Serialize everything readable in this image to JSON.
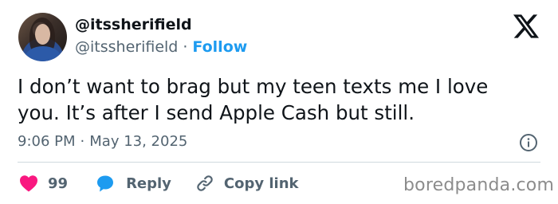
{
  "author": {
    "display_name": "@itssherifield",
    "handle": "@itssherifield",
    "follow_label": "Follow",
    "separator": "·"
  },
  "tweet": {
    "text": "I don’t want to brag but my teen texts me I love you. It’s after I send Apple Cash but still.",
    "time": "9:06 PM",
    "date": "May 13, 2025"
  },
  "actions": {
    "like_count": "99",
    "reply_label": "Reply",
    "copy_link_label": "Copy link"
  },
  "watermark": "boredpanda.com",
  "colors": {
    "accent": "#1d9bf0",
    "like": "#f91880",
    "secondary_text": "#536471",
    "divider": "#cfd9de"
  },
  "icons": {
    "logo": "x-logo-icon",
    "info": "info-icon",
    "like": "heart-icon",
    "reply": "speech-bubble-icon",
    "copy": "link-icon"
  }
}
